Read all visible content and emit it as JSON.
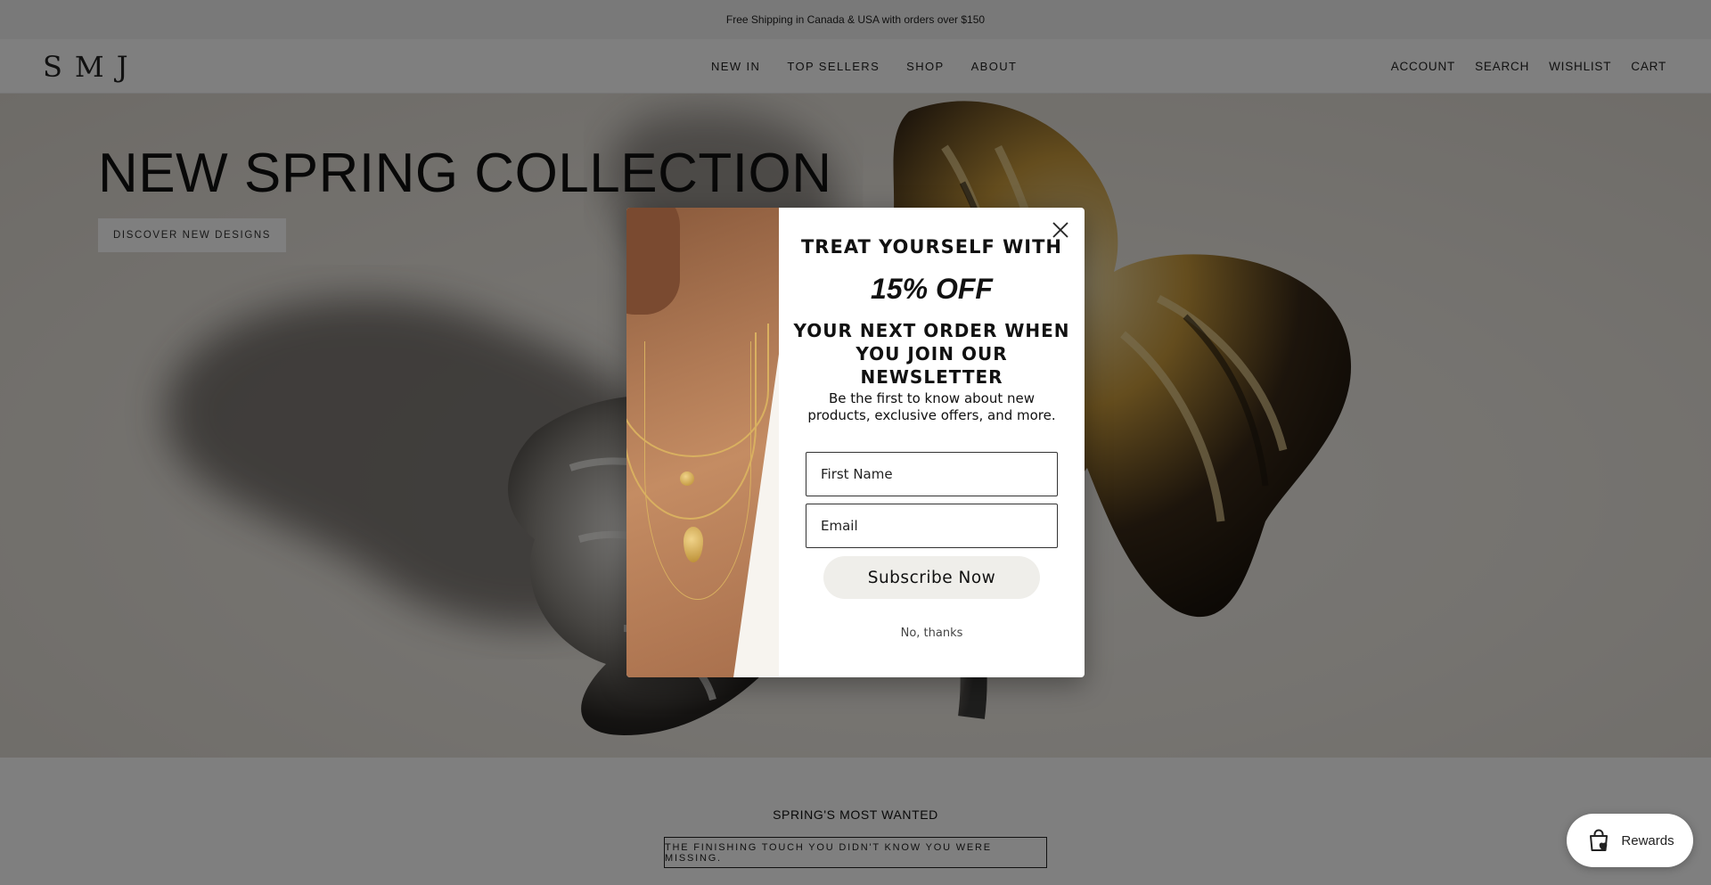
{
  "announcement": "Free Shipping in Canada & USA with orders over $150",
  "header": {
    "logo": "SMJ",
    "nav": [
      "NEW IN",
      "TOP SELLERS",
      "SHOP",
      "ABOUT"
    ],
    "utility": [
      "ACCOUNT",
      "SEARCH",
      "WISHLIST",
      "CART"
    ]
  },
  "hero": {
    "title": "NEW SPRING COLLECTION",
    "button": "DISCOVER NEW DESIGNS"
  },
  "section": {
    "title": "SPRING'S MOST WANTED",
    "tagline": "THE FINISHING TOUCH YOU DIDN'T KNOW YOU WERE MISSING."
  },
  "popup": {
    "heading1": "TREAT YOURSELF WITH",
    "offer": "15% OFF",
    "heading2": "YOUR NEXT ORDER WHEN YOU JOIN OUR NEWSLETTER",
    "description": "Be the first to know about new products, exclusive offers, and more.",
    "first_name_placeholder": "First Name",
    "email_placeholder": "Email",
    "subscribe_label": "Subscribe Now",
    "decline_label": "No, thanks"
  },
  "rewards": {
    "label": "Rewards",
    "icon": "shopping-bag-heart-icon"
  },
  "colors": {
    "overlay": "#000000",
    "subscribe_bg": "#efeeea",
    "text": "#111111"
  }
}
